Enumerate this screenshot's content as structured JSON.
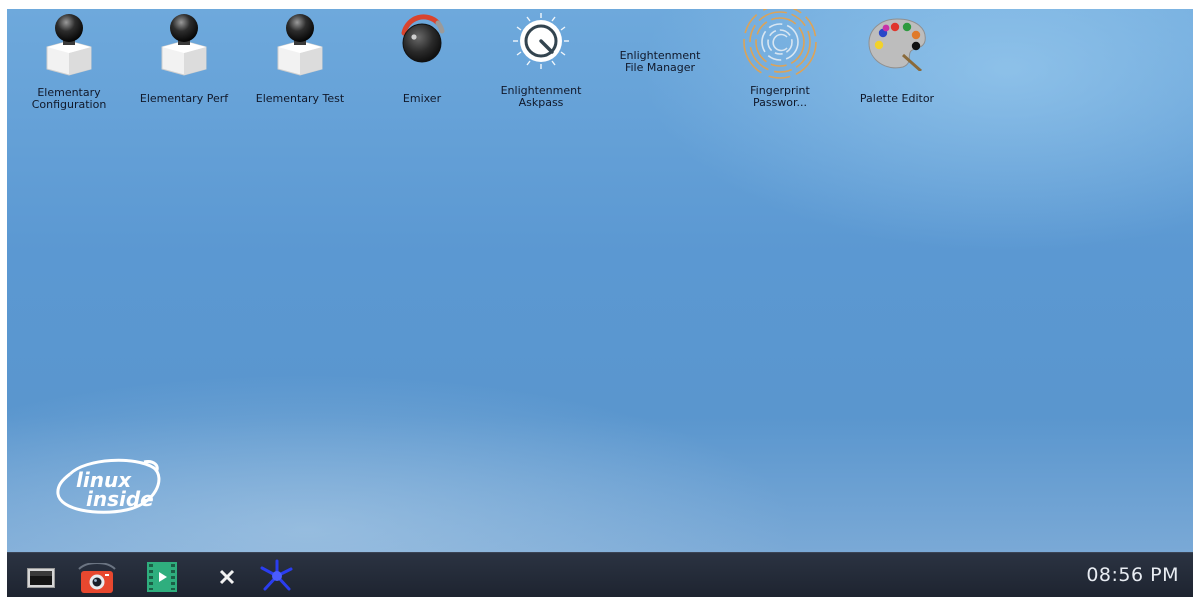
{
  "desktop_icons": [
    {
      "name": "elementary-configuration",
      "label": "Elementary\nConfiguration",
      "icon": "elementary-bust-icon"
    },
    {
      "name": "elementary-perf",
      "label": "Elementary Perf",
      "icon": "elementary-bust-icon"
    },
    {
      "name": "elementary-test",
      "label": "Elementary Test",
      "icon": "elementary-bust-icon"
    },
    {
      "name": "emixer",
      "label": "Emixer",
      "icon": "volume-knob-icon"
    },
    {
      "name": "enlightenment-askpass",
      "label": "Enlightenment\nAskpass",
      "icon": "askpass-dial-icon"
    },
    {
      "name": "enlightenment-file-manager",
      "label": "Enlightenment\nFile Manager",
      "icon": ""
    },
    {
      "name": "fingerprint-password",
      "label": "Fingerprint\nPasswor...",
      "icon": "fingerprint-icon"
    },
    {
      "name": "palette-editor",
      "label": "Palette Editor",
      "icon": "palette-icon"
    }
  ],
  "wallpaper_logo": {
    "text_line1": "linux",
    "text_line2": "inside"
  },
  "taskbar": {
    "items": [
      {
        "name": "terminal",
        "icon": "terminal-icon"
      },
      {
        "name": "screenshot",
        "icon": "camera-icon"
      },
      {
        "name": "media-player",
        "icon": "media-player-icon"
      },
      {
        "name": "close",
        "icon": "close-x-icon"
      },
      {
        "name": "enlightenment-menu",
        "icon": "enlightenment-star-icon"
      }
    ],
    "clock": "08:56 PM"
  },
  "colors": {
    "desktop_blue": "#5b98d2",
    "taskbar_bg": "#1e2430",
    "camera_red": "#e8482f",
    "player_green": "#2fae7e"
  }
}
